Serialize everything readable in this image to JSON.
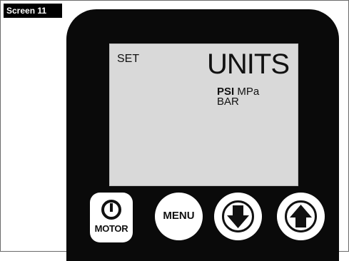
{
  "screen_tag": "Screen 11",
  "lcd": {
    "left_label": "SET",
    "title": "UNITS",
    "options": [
      {
        "label": "PSI",
        "selected": true
      },
      {
        "label": "MPa",
        "selected": false
      },
      {
        "label": "BAR",
        "selected": false
      }
    ]
  },
  "buttons": {
    "motor_label": "MOTOR",
    "menu_label": "MENU",
    "down_icon": "arrow-down-icon",
    "up_icon": "arrow-up-icon",
    "power_icon": "power-icon"
  },
  "colors": {
    "device": "#0a0a0a",
    "lcd": "#d9d9d9",
    "button": "#ffffff"
  }
}
